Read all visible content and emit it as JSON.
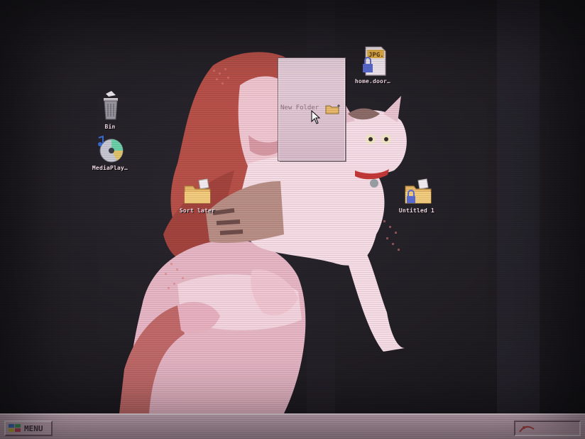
{
  "desktop": {
    "icons": [
      {
        "label": "Bin",
        "icon": "trash-bin-icon"
      },
      {
        "label": "MediaPlay…",
        "icon": "media-player-cd-icon"
      },
      {
        "label": "home.door…",
        "icon": "locked-jpg-file-icon"
      },
      {
        "label": "Sort later",
        "icon": "folder-icon"
      },
      {
        "label": "Untitled 1",
        "icon": "locked-folder-icon"
      }
    ]
  },
  "context_menu": {
    "item_label": "New Folder",
    "item_icon": "new-folder-icon"
  },
  "taskbar": {
    "menu_label": "MENU",
    "tray_icon": "system-tray-icon",
    "time": "",
    "date": ""
  },
  "colors": {
    "taskbar": "#d9bccb",
    "label_text": "#f6dfe8",
    "wallpaper_pink": "#f0c9d6",
    "wallpaper_red": "#c0584f"
  }
}
